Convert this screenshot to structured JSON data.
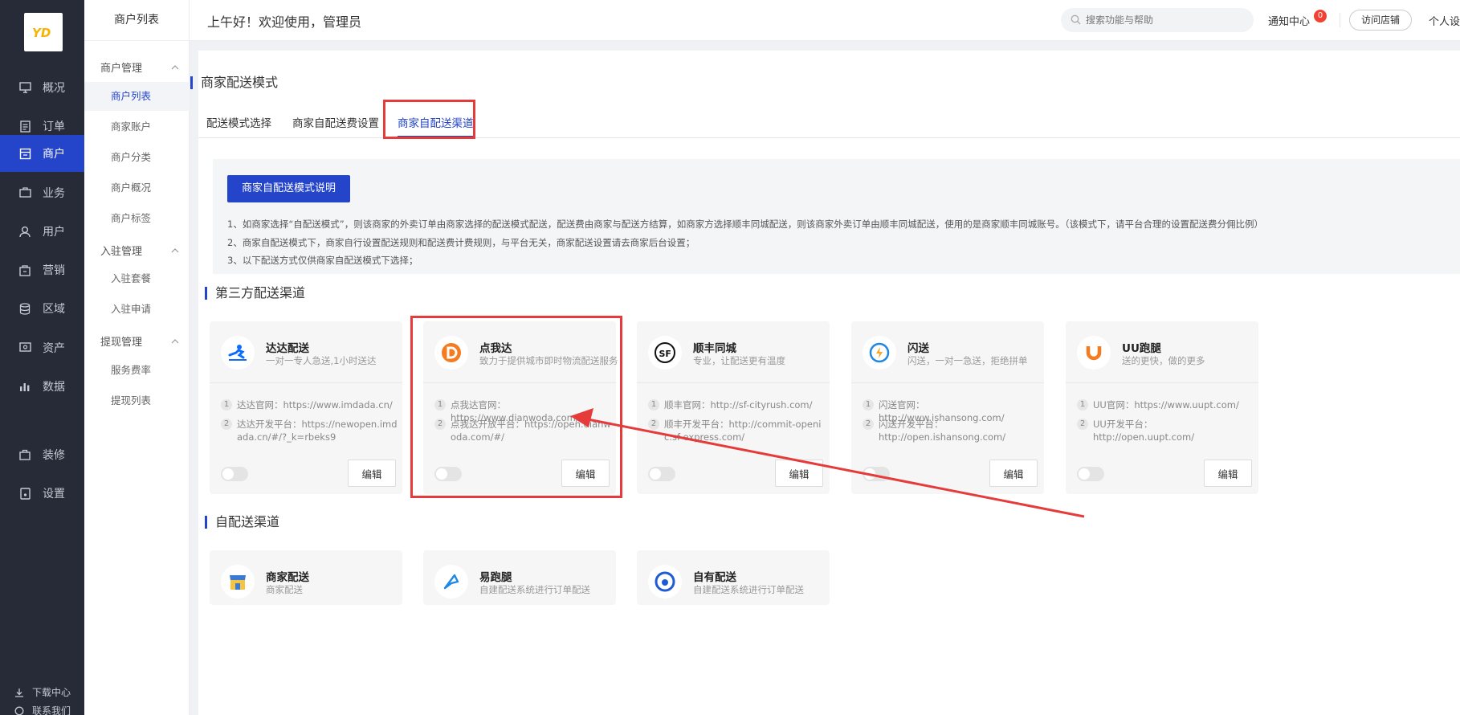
{
  "rail": {
    "items": [
      {
        "label": "概况",
        "icon": "monitor-icon"
      },
      {
        "label": "订单",
        "icon": "document-icon"
      },
      {
        "label": "商户",
        "icon": "shop-icon",
        "active": true
      },
      {
        "label": "业务",
        "icon": "briefcase-icon"
      },
      {
        "label": "用户",
        "icon": "user-icon"
      },
      {
        "label": "营销",
        "icon": "marketing-icon"
      },
      {
        "label": "区域",
        "icon": "database-icon"
      },
      {
        "label": "资产",
        "icon": "asset-icon"
      },
      {
        "label": "数据",
        "icon": "chart-icon"
      },
      {
        "label": "装修",
        "icon": "decorate-icon"
      },
      {
        "label": "设置",
        "icon": "settings-icon"
      }
    ],
    "download": "下载中心",
    "more": "联系我们"
  },
  "submenu": {
    "title": "商户列表",
    "groups": [
      {
        "label": "商户管理",
        "items": [
          "商户列表",
          "商家账户",
          "商户分类",
          "商户概况",
          "商户标签"
        ]
      },
      {
        "label": "入驻管理",
        "items": [
          "入驻套餐",
          "入驻申请"
        ]
      },
      {
        "label": "提现管理",
        "items": [
          "服务费率",
          "提现列表"
        ]
      }
    ]
  },
  "header": {
    "greeting": "上午好！欢迎使用，管理员",
    "search_placeholder": "搜索功能与帮助",
    "notice": "通知中心",
    "notice_count": "0",
    "visit_store": "访问店铺",
    "personal": "个人设"
  },
  "page": {
    "title": "商家配送模式",
    "tabs": [
      "配送模式选择",
      "商家自配送费设置",
      "商家自配送渠道"
    ],
    "active_tab": 2,
    "info_button": "商家自配送模式说明",
    "info_lines": [
      "1、如商家选择“自配送模式”，则该商家的外卖订单由商家选择的配送模式配送，配送费由商家与配送方结算，如商家方选择顺丰同城配送，则该商家外卖订单由顺丰同城配送，使用的是商家顺丰同城账号。（该模式下，请平台合理的设置配送费分佣比例）",
      "2、商家自配送模式下，商家自行设置配送规则和配送费计费规则，与平台无关，商家配送设置请去商家后台设置；",
      "3、以下配送方式仅供商家自配送模式下选择；"
    ],
    "third_party_title": "第三方配送渠道",
    "third_party": [
      {
        "name": "达达配送",
        "desc": "一对一专人急送,1小时送达",
        "icon": "dada-logo-icon",
        "links": [
          "达达官网：https://www.imdada.cn/",
          "达达开发平台：https://newopen.imdada.cn/#/?_k=rbeks9"
        ],
        "edit": "编辑"
      },
      {
        "name": "点我达",
        "desc": "致力于提供城市即时物流配送服务",
        "icon": "dianwoda-logo-icon",
        "links": [
          "点我达官网：https://www.dianwoda.com/",
          "点我达开放平台：https://open.dianwoda.com/#/"
        ],
        "edit": "编辑"
      },
      {
        "name": "顺丰同城",
        "desc": "专业，让配送更有温度",
        "icon": "sf-logo-icon",
        "links": [
          "顺丰官网：http://sf-cityrush.com/",
          "顺丰开发平台：http://commit-openic.sf-express.com/"
        ],
        "edit": "编辑"
      },
      {
        "name": "闪送",
        "desc": "闪送，一对一急送，拒绝拼单",
        "icon": "shansong-logo-icon",
        "links": [
          "闪送官网：http://www.ishansong.com/",
          "闪送开发平台：http://open.ishansong.com/"
        ],
        "edit": "编辑"
      },
      {
        "name": "UU跑腿",
        "desc": "送的更快，做的更多",
        "icon": "uu-logo-icon",
        "links": [
          "UU官网：https://www.uupt.com/",
          "UU开发平台：http://open.uupt.com/"
        ],
        "edit": "编辑"
      }
    ],
    "self_title": "自配送渠道",
    "self": [
      {
        "name": "商家配送",
        "desc": "商家配送",
        "icon": "store-logo-icon"
      },
      {
        "name": "易跑腿",
        "desc": "自建配送系统进行订单配送",
        "icon": "yipaotui-logo-icon"
      },
      {
        "name": "自有配送",
        "desc": "自建配送系统进行订单配送",
        "icon": "own-delivery-logo-icon"
      }
    ]
  },
  "colors": {
    "accent": "#2445c9",
    "highlight": "#e53b3b",
    "rail_bg": "#262b37"
  }
}
